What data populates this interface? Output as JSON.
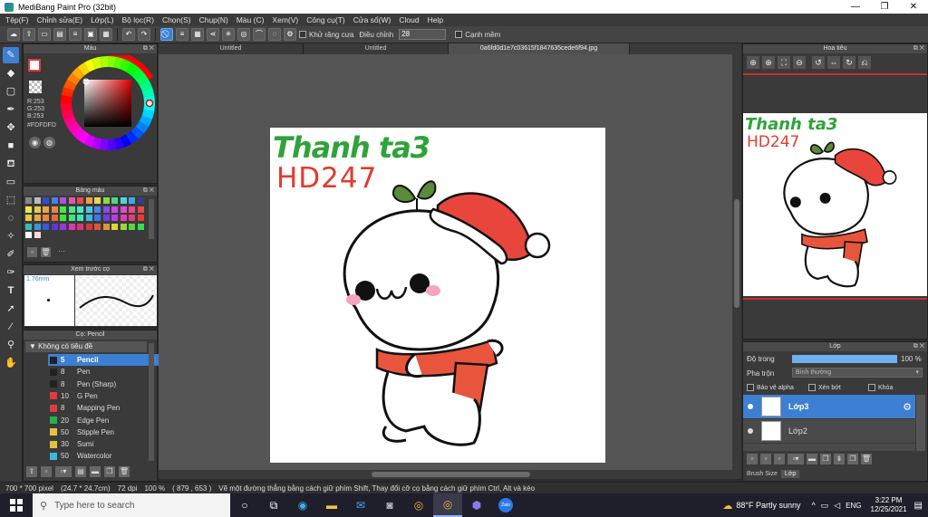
{
  "window": {
    "title": "MediBang Paint Pro (32bit)",
    "min": "—",
    "max": "❐",
    "close": "✕"
  },
  "menu": [
    "Tệp(F)",
    "Chỉnh sửa(E)",
    "Lớp(L)",
    "Bộ lọc(R)",
    "Chọn(S)",
    "Chụp(N)",
    "Màu (C)",
    "Xem(V)",
    "Công cụ(T)",
    "Cửa sổ(W)",
    "Cloud",
    "Help"
  ],
  "toolbar": {
    "antialias_label": "Khử răng cưa",
    "adjust_label": "Điều chỉnh",
    "adjust_value": "28",
    "sharpen_label": "Cạnh mềm"
  },
  "color_panel": {
    "title": "Màu",
    "rgb": [
      "R:253",
      "G:253",
      "B:253"
    ],
    "hex": "#FDFDFD"
  },
  "palette_panel": {
    "title": "Bảng màu",
    "more": "···"
  },
  "brush_preview": {
    "title": "Xem trước cọ",
    "size": "1.76mm"
  },
  "brush_panel": {
    "title": "Cọ: Pencil",
    "group": "Không có tiêu đề",
    "items": [
      {
        "size": "5",
        "name": "Pencil",
        "color": "#222222"
      },
      {
        "size": "8",
        "name": "Pen",
        "color": "#222222"
      },
      {
        "size": "8",
        "name": "Pen (Sharp)",
        "color": "#222222"
      },
      {
        "size": "10",
        "name": "G Pen",
        "color": "#e23b3b"
      },
      {
        "size": "8",
        "name": "Mapping Pen",
        "color": "#e23b3b"
      },
      {
        "size": "20",
        "name": "Edge Pen",
        "color": "#22b14c"
      },
      {
        "size": "50",
        "name": "Stipple Pen",
        "color": "#e2c43b"
      },
      {
        "size": "30",
        "name": "Sumi",
        "color": "#e2c43b"
      },
      {
        "size": "50",
        "name": "Watercolor",
        "color": "#3bb8e2"
      }
    ]
  },
  "tabs": [
    "Untitled",
    "Untitled",
    "0a6fd0d1e7c03615f1847635cede6f94.jpg"
  ],
  "artwork": {
    "line1": "Thanh ta3",
    "line2": "HD247"
  },
  "navigator": {
    "title": "Hoa tiêu"
  },
  "layer_panel": {
    "title": "Lớp",
    "opacity_label": "Độ trong",
    "opacity_value": "100 %",
    "blend_label": "Pha trộn",
    "blend_value": "Bình thường",
    "protect_alpha": "Bảo vệ alpha",
    "clipping": "Xén bớt",
    "lock": "Khóa",
    "layers": [
      "Lớp3",
      "Lớp2"
    ],
    "bottom_tabs": [
      "Brush Size",
      "Lớp"
    ]
  },
  "status": {
    "size": "700 * 700 pixel",
    "physical": "(24.7 * 24.7cm)",
    "dpi": "72 dpi",
    "zoom": "100 %",
    "coords": "( 879 , 653 )",
    "hint": "Vẽ một đường thẳng bằng cách giữ phím Shift, Thay đổi cỡ cọ bằng cách giữ phím Ctrl, Alt và kéo"
  },
  "taskbar": {
    "search_placeholder": "Type here to search",
    "weather": "88°F  Partly sunny",
    "lang": "ENG",
    "time": "3:22 PM",
    "date": "12/25/2021",
    "app_label": "Zalo"
  },
  "colors": {
    "accent": "#3d7fd3",
    "green_text": "#2fa33a",
    "red_text": "#e23b2b"
  }
}
